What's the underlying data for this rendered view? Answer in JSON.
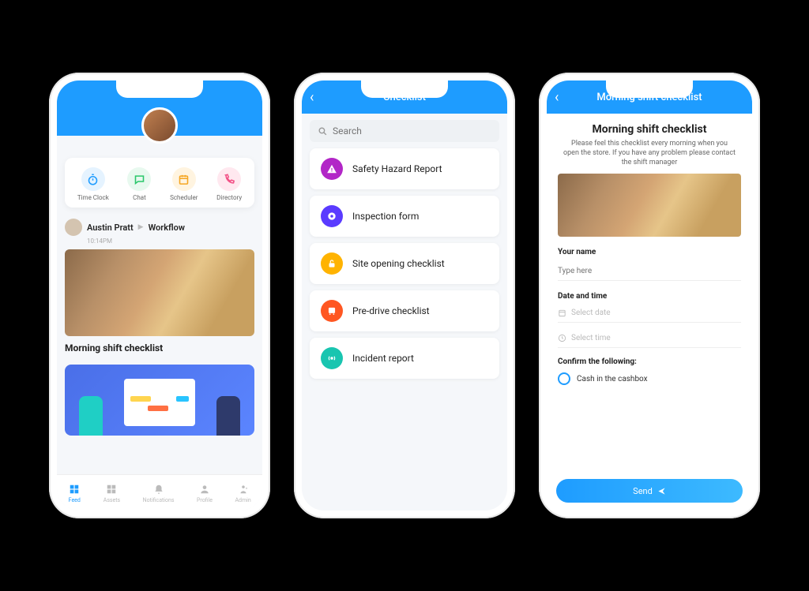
{
  "phone1": {
    "quick": [
      {
        "label": "Time Clock",
        "bg": "#e5f3ff",
        "fg": "#1e9cff"
      },
      {
        "label": "Chat",
        "bg": "#e8f9ef",
        "fg": "#2bc76b"
      },
      {
        "label": "Scheduler",
        "bg": "#fff4e0",
        "fg": "#f5a623"
      },
      {
        "label": "Directory",
        "bg": "#ffe8ef",
        "fg": "#f25086"
      }
    ],
    "post": {
      "author": "Austin Pratt",
      "target": "Workflow",
      "time": "10:14PM",
      "title": "Morning shift checklist"
    },
    "tabs": [
      {
        "label": "Feed"
      },
      {
        "label": "Assets"
      },
      {
        "label": "Notifications"
      },
      {
        "label": "Profile"
      },
      {
        "label": "Admin"
      }
    ]
  },
  "phone2": {
    "header": "Checklist",
    "searchPlaceholder": "Search",
    "items": [
      {
        "label": "Safety Hazard Report",
        "bg": "#b226c7"
      },
      {
        "label": "Inspection form",
        "bg": "#5a3bff"
      },
      {
        "label": "Site opening checklist",
        "bg": "#ffb300"
      },
      {
        "label": "Pre-drive checklist",
        "bg": "#ff5722"
      },
      {
        "label": "Incident report",
        "bg": "#19c5b0"
      }
    ]
  },
  "phone3": {
    "header": "Morning shift checklist",
    "title": "Morning shift checklist",
    "desc": "Please feel this checklist every morning when you open the store. If you have any problem please contact the shift manager",
    "fields": {
      "nameLabel": "Your name",
      "namePlaceholder": "Type here",
      "dateLabel": "Date and time",
      "selectDate": "Select date",
      "selectTime": "Select time",
      "confirmLabel": "Confirm the following:",
      "checkItem": "Cash in the cashbox"
    },
    "sendLabel": "Send"
  }
}
